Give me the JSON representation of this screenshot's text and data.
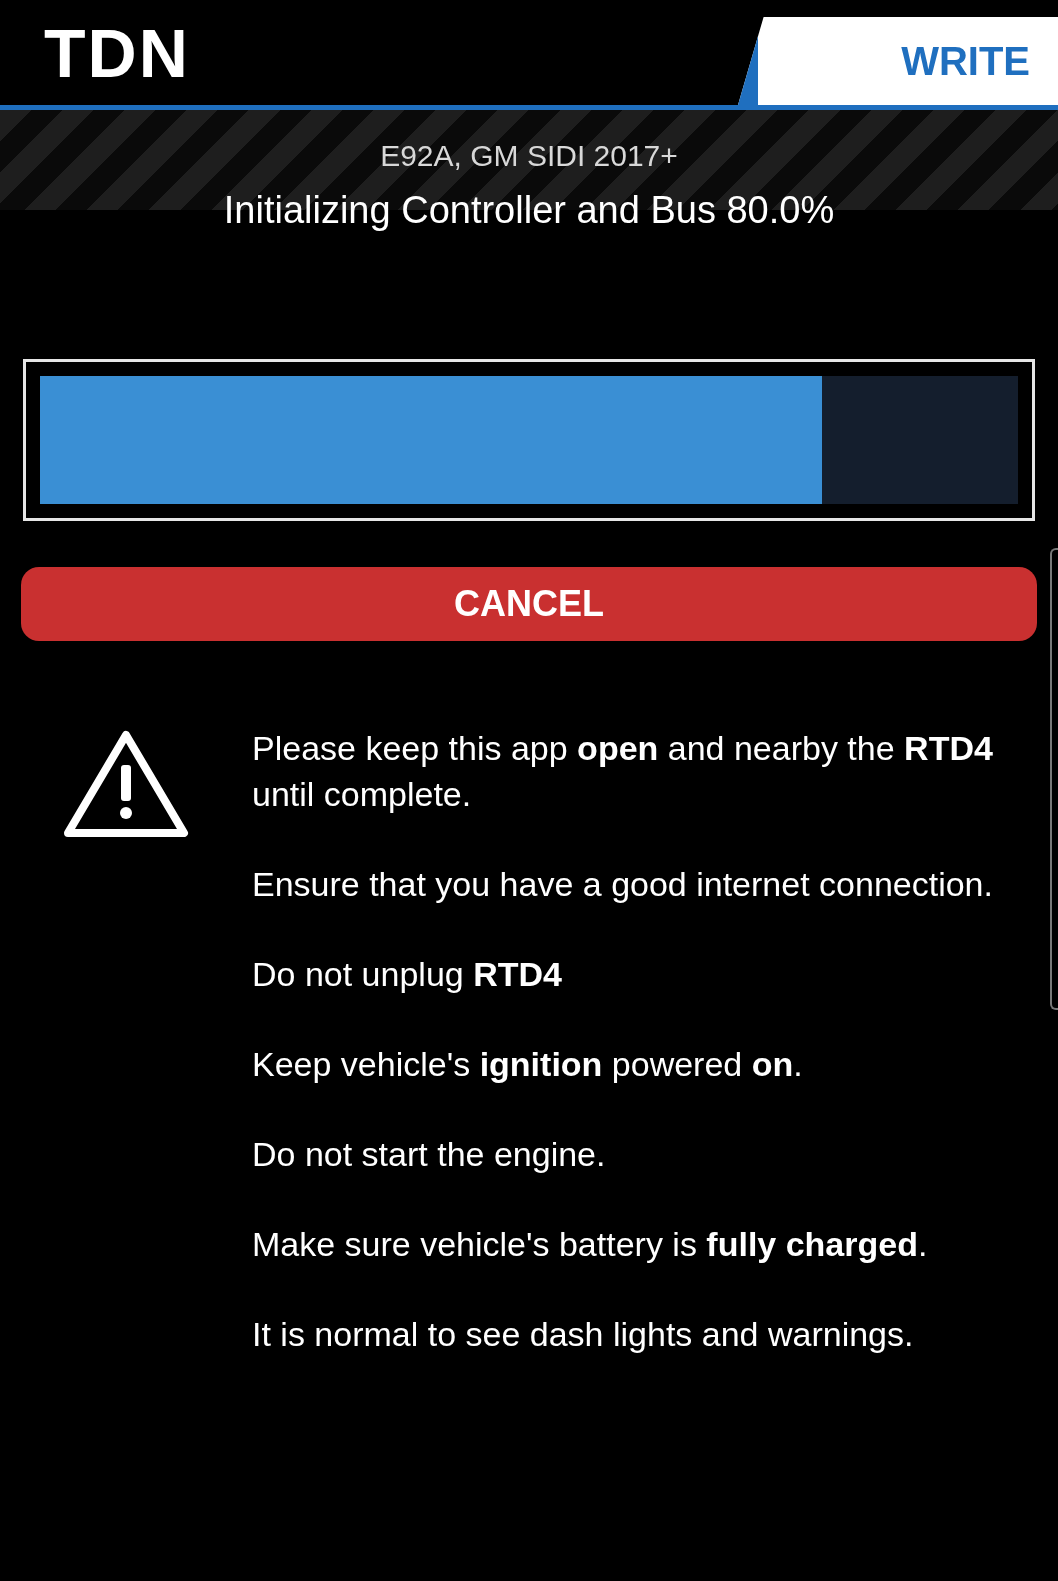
{
  "header": {
    "logo": "TDN",
    "mode": "WRITE"
  },
  "vehicle": "E92A, GM SIDI 2017+",
  "status": "Initializing Controller and Bus 80.0%",
  "progress": {
    "level": 0.8
  },
  "cancel_button": "CANCEL",
  "instructions": [
    "Please keep this app **open** and nearby the **RTD4** until complete.",
    "Ensure that you have a good internet connection.",
    "Do not unplug **RTD4**",
    "Keep vehicle's **ignition** powered **on**.",
    "Do not start the engine.",
    "Make sure vehicle's battery is **fully charged**.",
    "It is normal to see dash lights and warnings."
  ]
}
